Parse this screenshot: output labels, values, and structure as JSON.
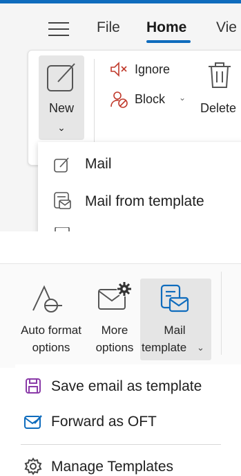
{
  "top": {
    "menu_tabs": [
      "File",
      "Home",
      "Vie"
    ],
    "ribbon": {
      "new_label": "New",
      "ignore_label": "Ignore",
      "block_label": "Block",
      "delete_label": "Delete"
    },
    "new_menu": {
      "items": [
        {
          "label": "Mail",
          "icon": "compose-icon"
        },
        {
          "label": "Mail from template",
          "icon": "mail-template-icon"
        }
      ]
    }
  },
  "bottom": {
    "options": {
      "auto_format_line1": "Auto format",
      "auto_format_line2": "options",
      "more_options_line1": "More",
      "more_options_line2": "options",
      "mail_template_line1": "Mail",
      "mail_template_line2": "template"
    },
    "template_menu": {
      "items": [
        {
          "label": "Save email as template",
          "icon": "save-icon"
        },
        {
          "label": "Forward as OFT",
          "icon": "envelope-edit-icon"
        },
        {
          "label": "Manage Templates",
          "icon": "gear-icon"
        }
      ]
    }
  },
  "colors": {
    "accent": "#0f6cbd",
    "save_icon": "#8a3aa8",
    "mail_template_icon": "#0f6cbd"
  }
}
